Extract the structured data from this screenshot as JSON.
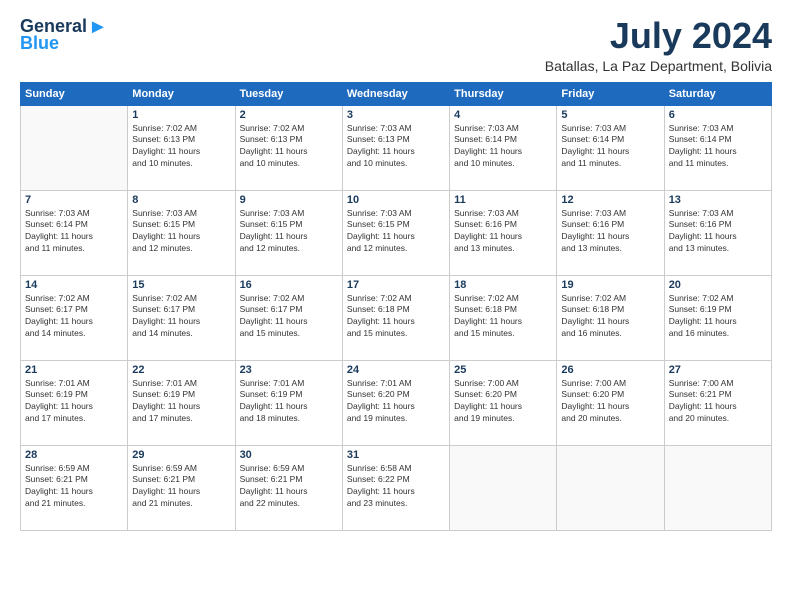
{
  "logo": {
    "general": "General",
    "blue": "Blue"
  },
  "title": {
    "month_year": "July 2024",
    "location": "Batallas, La Paz Department, Bolivia"
  },
  "calendar": {
    "headers": [
      "Sunday",
      "Monday",
      "Tuesday",
      "Wednesday",
      "Thursday",
      "Friday",
      "Saturday"
    ],
    "weeks": [
      [
        {
          "day": "",
          "info": ""
        },
        {
          "day": "1",
          "info": "Sunrise: 7:02 AM\nSunset: 6:13 PM\nDaylight: 11 hours\nand 10 minutes."
        },
        {
          "day": "2",
          "info": "Sunrise: 7:02 AM\nSunset: 6:13 PM\nDaylight: 11 hours\nand 10 minutes."
        },
        {
          "day": "3",
          "info": "Sunrise: 7:03 AM\nSunset: 6:13 PM\nDaylight: 11 hours\nand 10 minutes."
        },
        {
          "day": "4",
          "info": "Sunrise: 7:03 AM\nSunset: 6:14 PM\nDaylight: 11 hours\nand 10 minutes."
        },
        {
          "day": "5",
          "info": "Sunrise: 7:03 AM\nSunset: 6:14 PM\nDaylight: 11 hours\nand 11 minutes."
        },
        {
          "day": "6",
          "info": "Sunrise: 7:03 AM\nSunset: 6:14 PM\nDaylight: 11 hours\nand 11 minutes."
        }
      ],
      [
        {
          "day": "7",
          "info": "Sunrise: 7:03 AM\nSunset: 6:14 PM\nDaylight: 11 hours\nand 11 minutes."
        },
        {
          "day": "8",
          "info": "Sunrise: 7:03 AM\nSunset: 6:15 PM\nDaylight: 11 hours\nand 12 minutes."
        },
        {
          "day": "9",
          "info": "Sunrise: 7:03 AM\nSunset: 6:15 PM\nDaylight: 11 hours\nand 12 minutes."
        },
        {
          "day": "10",
          "info": "Sunrise: 7:03 AM\nSunset: 6:15 PM\nDaylight: 11 hours\nand 12 minutes."
        },
        {
          "day": "11",
          "info": "Sunrise: 7:03 AM\nSunset: 6:16 PM\nDaylight: 11 hours\nand 13 minutes."
        },
        {
          "day": "12",
          "info": "Sunrise: 7:03 AM\nSunset: 6:16 PM\nDaylight: 11 hours\nand 13 minutes."
        },
        {
          "day": "13",
          "info": "Sunrise: 7:03 AM\nSunset: 6:16 PM\nDaylight: 11 hours\nand 13 minutes."
        }
      ],
      [
        {
          "day": "14",
          "info": "Sunrise: 7:02 AM\nSunset: 6:17 PM\nDaylight: 11 hours\nand 14 minutes."
        },
        {
          "day": "15",
          "info": "Sunrise: 7:02 AM\nSunset: 6:17 PM\nDaylight: 11 hours\nand 14 minutes."
        },
        {
          "day": "16",
          "info": "Sunrise: 7:02 AM\nSunset: 6:17 PM\nDaylight: 11 hours\nand 15 minutes."
        },
        {
          "day": "17",
          "info": "Sunrise: 7:02 AM\nSunset: 6:18 PM\nDaylight: 11 hours\nand 15 minutes."
        },
        {
          "day": "18",
          "info": "Sunrise: 7:02 AM\nSunset: 6:18 PM\nDaylight: 11 hours\nand 15 minutes."
        },
        {
          "day": "19",
          "info": "Sunrise: 7:02 AM\nSunset: 6:18 PM\nDaylight: 11 hours\nand 16 minutes."
        },
        {
          "day": "20",
          "info": "Sunrise: 7:02 AM\nSunset: 6:19 PM\nDaylight: 11 hours\nand 16 minutes."
        }
      ],
      [
        {
          "day": "21",
          "info": "Sunrise: 7:01 AM\nSunset: 6:19 PM\nDaylight: 11 hours\nand 17 minutes."
        },
        {
          "day": "22",
          "info": "Sunrise: 7:01 AM\nSunset: 6:19 PM\nDaylight: 11 hours\nand 17 minutes."
        },
        {
          "day": "23",
          "info": "Sunrise: 7:01 AM\nSunset: 6:19 PM\nDaylight: 11 hours\nand 18 minutes."
        },
        {
          "day": "24",
          "info": "Sunrise: 7:01 AM\nSunset: 6:20 PM\nDaylight: 11 hours\nand 19 minutes."
        },
        {
          "day": "25",
          "info": "Sunrise: 7:00 AM\nSunset: 6:20 PM\nDaylight: 11 hours\nand 19 minutes."
        },
        {
          "day": "26",
          "info": "Sunrise: 7:00 AM\nSunset: 6:20 PM\nDaylight: 11 hours\nand 20 minutes."
        },
        {
          "day": "27",
          "info": "Sunrise: 7:00 AM\nSunset: 6:21 PM\nDaylight: 11 hours\nand 20 minutes."
        }
      ],
      [
        {
          "day": "28",
          "info": "Sunrise: 6:59 AM\nSunset: 6:21 PM\nDaylight: 11 hours\nand 21 minutes."
        },
        {
          "day": "29",
          "info": "Sunrise: 6:59 AM\nSunset: 6:21 PM\nDaylight: 11 hours\nand 21 minutes."
        },
        {
          "day": "30",
          "info": "Sunrise: 6:59 AM\nSunset: 6:21 PM\nDaylight: 11 hours\nand 22 minutes."
        },
        {
          "day": "31",
          "info": "Sunrise: 6:58 AM\nSunset: 6:22 PM\nDaylight: 11 hours\nand 23 minutes."
        },
        {
          "day": "",
          "info": ""
        },
        {
          "day": "",
          "info": ""
        },
        {
          "day": "",
          "info": ""
        }
      ]
    ]
  }
}
